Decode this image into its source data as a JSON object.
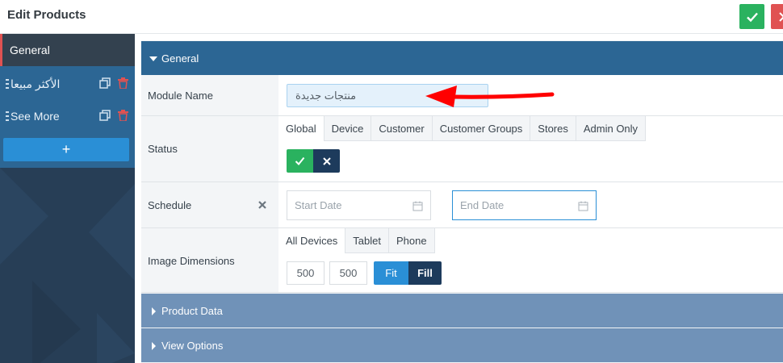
{
  "header": {
    "title": "Edit Products"
  },
  "sidebar": {
    "items": [
      {
        "label": "General",
        "active": true
      },
      {
        "label": "الأكثر مبيعا",
        "active": false
      },
      {
        "label": "See More",
        "active": false
      }
    ],
    "add_label": "+"
  },
  "panels": {
    "general": {
      "title": "General",
      "expanded": true
    },
    "product_data": {
      "title": "Product Data",
      "expanded": false
    },
    "view_options": {
      "title": "View Options",
      "expanded": false
    }
  },
  "fields": {
    "module_name": {
      "label": "Module Name",
      "value": "منتجات جديدة"
    },
    "status": {
      "label": "Status",
      "tabs": [
        "Global",
        "Device",
        "Customer",
        "Customer Groups",
        "Stores",
        "Admin Only"
      ],
      "active_tab": "Global",
      "value": "on"
    },
    "schedule": {
      "label": "Schedule",
      "start_placeholder": "Start Date",
      "end_placeholder": "End Date"
    },
    "image_dimensions": {
      "label": "Image Dimensions",
      "tabs": [
        "All Devices",
        "Tablet",
        "Phone"
      ],
      "active_tab": "All Devices",
      "width": "500",
      "height": "500",
      "mode_options": [
        "Fit",
        "Fill"
      ],
      "selected_mode": "Fit"
    }
  },
  "colors": {
    "save": "#2ab25f",
    "close": "#e05252",
    "panel_active": "#2c6694",
    "panel_collapsed": "#7092b8",
    "primary": "#2a8fd6",
    "dark": "#1d3b5c",
    "annotation_arrow": "#ff0000"
  }
}
